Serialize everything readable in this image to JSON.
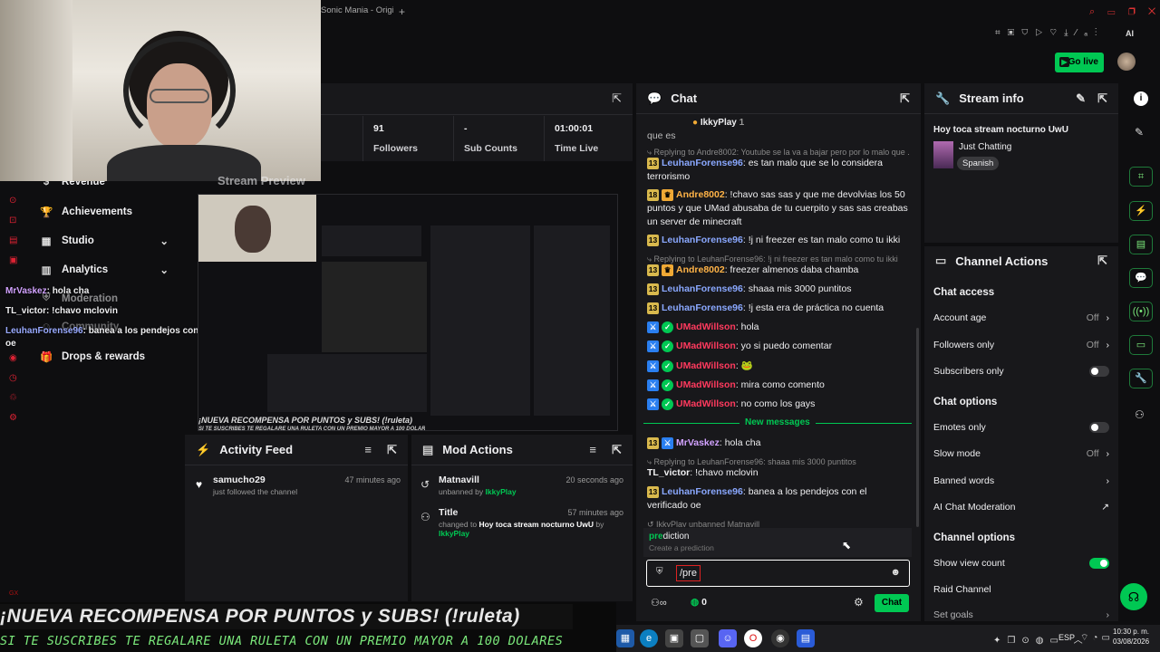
{
  "browser": {
    "tab_title": "Sonic Mania - Origi"
  },
  "header": {
    "go_live": "Go live"
  },
  "stats": [
    {
      "number": "91",
      "label": "Followers"
    },
    {
      "number": "-",
      "label": "Sub Counts"
    },
    {
      "number": "01:00:01",
      "label": "Time Live"
    }
  ],
  "sidebar": {
    "items": [
      "Revenue",
      "Achievements",
      "Studio",
      "Analytics",
      "Moderation",
      "Community",
      "Drops & rewards"
    ]
  },
  "preview": {
    "title": "Stream Preview"
  },
  "overlay_chat": [
    {
      "user": "MrVaskez",
      "text": "hola cha"
    },
    {
      "user": "TL_victor",
      "text": "!chavo mclovin"
    },
    {
      "user": "LeuhanForense96",
      "text": "banea a los pendejos con el verificado",
      "extra": "oe"
    }
  ],
  "chat": {
    "title": "Chat",
    "pinned_user": "IkkyPlay",
    "pinned_count": "1",
    "top_fragment": "que es",
    "new_messages": "New messages",
    "autocomplete_title": "prediction",
    "autocomplete_sub": "Create a prediction",
    "input_value": "/pre",
    "points": "0",
    "send_label": "Chat",
    "system_line": "IkkyPlay unbanned Matnavill",
    "messages": [
      {
        "reply": "Replying to Andre8002: Youtube se la va a bajar pero por lo malo que ..."
      },
      {
        "badge": "13",
        "user": "LeuhanForense96",
        "text": "es tan malo que se lo considera terrorismo"
      },
      {
        "badge": "18",
        "user": "Andre8002",
        "text": "!chavo sas sas y que me devolvias los 50 puntos y que UMad abusaba de tu cuerpito y sas sas creabas un server de minecraft"
      },
      {
        "badge": "13",
        "user": "LeuhanForense96",
        "text": "!j ni freezer es tan malo como tu ikki"
      },
      {
        "reply": "Replying to LeuhanForense96: !j ni freezer es tan malo como tu ikki"
      },
      {
        "badge": "13",
        "user": "Andre8002",
        "text": "freezer almenos daba chamba"
      },
      {
        "badge": "13",
        "user": "LeuhanForense96",
        "text": "shaaa mis 3000 puntitos"
      },
      {
        "badge": "13",
        "user": "LeuhanForense96",
        "text": "!j esta era de práctica no cuenta"
      },
      {
        "user": "UMadWillson",
        "text": "hola"
      },
      {
        "user": "UMadWillson",
        "text": "yo si puedo comentar"
      },
      {
        "user": "UMadWillson",
        "text": "🐸"
      },
      {
        "user": "UMadWillson",
        "text": "mira como comento"
      },
      {
        "user": "UMadWillson",
        "text": "no como los gays"
      },
      {
        "badge": "13",
        "user": "MrVaskez",
        "text": "hola cha"
      },
      {
        "reply": "Replying to LeuhanForense96: shaaa mis 3000 puntitos"
      },
      {
        "user": "TL_victor",
        "text": "!chavo mclovin"
      },
      {
        "badge": "13",
        "user": "LeuhanForense96",
        "text": "banea a los pendejos con el verificado oe"
      }
    ]
  },
  "stream_info": {
    "title": "Stream info",
    "stream_title": "Hoy toca stream nocturno UwU",
    "category": "Just Chatting",
    "language": "Spanish"
  },
  "channel_actions": {
    "title": "Channel Actions",
    "chat_access": "Chat access",
    "account_age": "Account age",
    "account_age_val": "Off",
    "followers_only": "Followers only",
    "followers_only_val": "Off",
    "subscribers_only": "Subscribers only",
    "chat_options": "Chat options",
    "emotes_only": "Emotes only",
    "slow_mode": "Slow mode",
    "slow_mode_val": "Off",
    "banned_words": "Banned words",
    "ai_moderation": "AI Chat Moderation",
    "channel_options": "Channel options",
    "show_view_count": "Show view count",
    "raid_channel": "Raid Channel",
    "cut_row": "Set goals"
  },
  "activity": {
    "title": "Activity Feed",
    "items": [
      {
        "user": "samucho29",
        "action": "just followed the channel",
        "time": "47 minutes ago"
      }
    ]
  },
  "mod_actions": {
    "title": "Mod Actions",
    "items": [
      {
        "title": "Matnavill",
        "action": "unbanned by",
        "by": "IkkyPlay",
        "time": "20 seconds ago"
      },
      {
        "title": "Title",
        "action": "changed to",
        "value": "Hoy toca stream nocturno UwU",
        "by": "IkkyPlay",
        "time": "57 minutes ago"
      }
    ]
  },
  "banner": {
    "line1": "¡NUEVA RECOMPENSA POR PUNTOS y SUBS! (!ruleta)",
    "line2": "SI TE SUSCRIBES TE REGALARE UNA RULETA CON UN PREMIO MAYOR A 100 DOLARES"
  },
  "taskbar": {
    "lang": "ESP",
    "time": "10:30 p. m.",
    "date": "03/08/2026"
  },
  "colors": {
    "accent": "#00c853",
    "panel": "#18181b",
    "bg": "#0e0e10"
  }
}
